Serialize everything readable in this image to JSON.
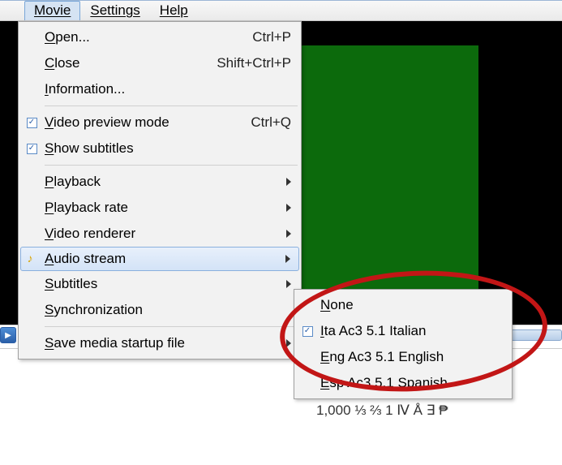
{
  "menubar": {
    "items": [
      "Movie",
      "Settings",
      "Help"
    ],
    "active_index": 0
  },
  "mainmenu": [
    {
      "type": "item",
      "label_pre": "",
      "label_u": "O",
      "label_post": "pen...",
      "shortcut": "Ctrl+P"
    },
    {
      "type": "item",
      "label_pre": "",
      "label_u": "C",
      "label_post": "lose",
      "shortcut": "Shift+Ctrl+P"
    },
    {
      "type": "item",
      "label_pre": "",
      "label_u": "I",
      "label_post": "nformation..."
    },
    {
      "type": "sep"
    },
    {
      "type": "item",
      "checked": true,
      "label_pre": "",
      "label_u": "V",
      "label_post": "ideo preview mode",
      "shortcut": "Ctrl+Q"
    },
    {
      "type": "item",
      "checked": true,
      "label_pre": "",
      "label_u": "S",
      "label_post": "how subtitles"
    },
    {
      "type": "sep"
    },
    {
      "type": "item",
      "label_pre": "",
      "label_u": "P",
      "label_post": "layback",
      "submenu": true
    },
    {
      "type": "item",
      "label_pre": "",
      "label_u": "P",
      "label_post": "layback rate",
      "submenu": true
    },
    {
      "type": "item",
      "label_pre": "",
      "label_u": "V",
      "label_post": "ideo renderer",
      "submenu": true
    },
    {
      "type": "item",
      "highlight": true,
      "icon": "note",
      "label_pre": "",
      "label_u": "A",
      "label_post": "udio stream",
      "submenu": true
    },
    {
      "type": "item",
      "label_pre": "",
      "label_u": "S",
      "label_post": "ubtitles",
      "submenu": true
    },
    {
      "type": "item",
      "label_pre": "",
      "label_u": "S",
      "label_post": "ynchronization"
    },
    {
      "type": "sep"
    },
    {
      "type": "item",
      "label_pre": "",
      "label_u": "S",
      "label_post": "ave media startup file",
      "submenu": true
    }
  ],
  "submenu": {
    "items": [
      {
        "label_pre": "",
        "label_u": "N",
        "label_post": "one"
      },
      {
        "checked": true,
        "label_pre": "",
        "label_u": "I",
        "label_post": "ta Ac3 5.1 Italian"
      },
      {
        "label_pre": "",
        "label_u": "E",
        "label_post": "ng Ac3 5.1 English"
      },
      {
        "label_pre": "",
        "label_u": "E",
        "label_post": "sp Ac3 5.1 Spanish"
      }
    ]
  },
  "bottom_text": "1,000  ⅓ ⅔ 1 Ⅳ Å ∃ ₱"
}
